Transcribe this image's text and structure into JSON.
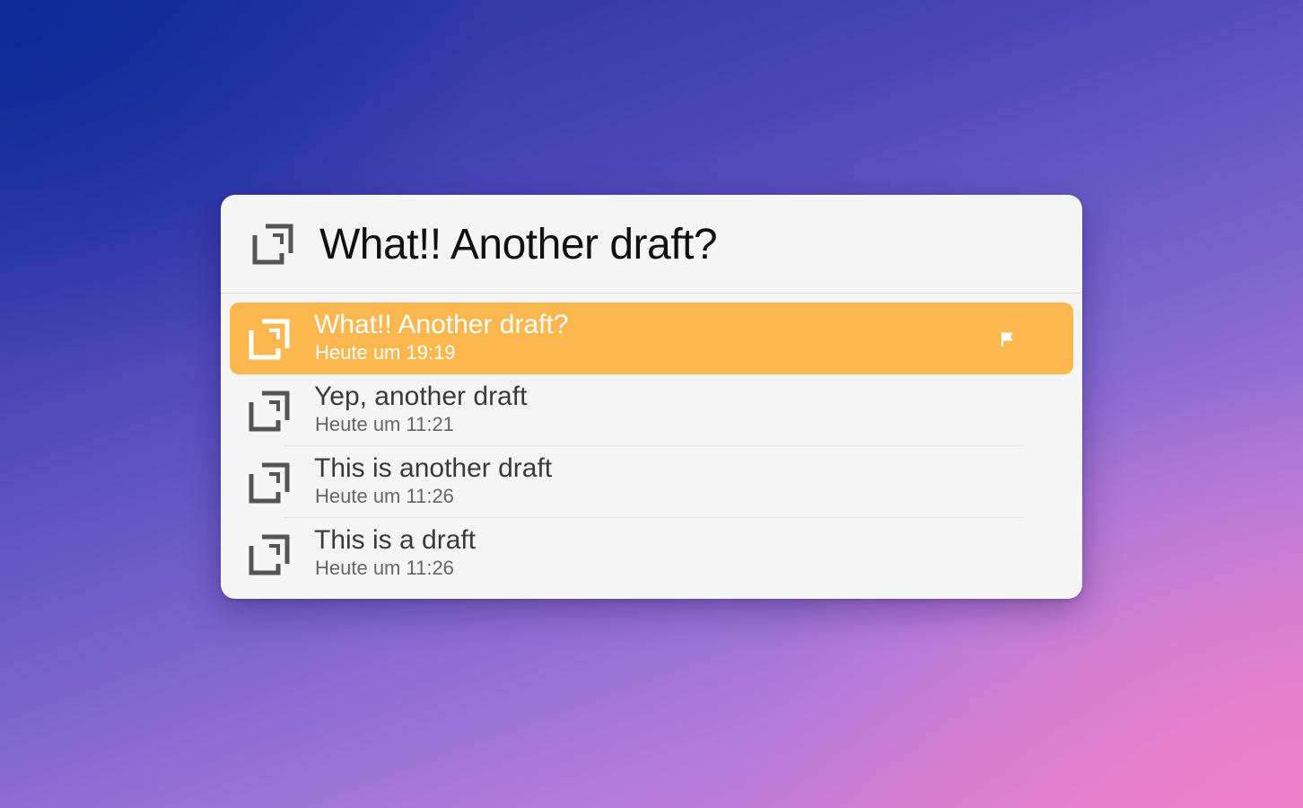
{
  "search": {
    "query": "What!! Another draft?",
    "icon": "draft-document-icon"
  },
  "results": [
    {
      "title": "What!! Another draft?",
      "subtitle": "Heute um 19:19",
      "icon": "draft-document-icon",
      "selected": true,
      "flag_icon": "flag-icon"
    },
    {
      "title": "Yep, another draft",
      "subtitle": "Heute um 11:21",
      "icon": "draft-document-icon",
      "selected": false
    },
    {
      "title": "This is another draft",
      "subtitle": "Heute um 11:26",
      "icon": "draft-document-icon",
      "selected": false
    },
    {
      "title": "This is a draft",
      "subtitle": "Heute um 11:26",
      "icon": "draft-document-icon",
      "selected": false
    }
  ],
  "colors": {
    "selection": "#fcb84f",
    "panel_background": "#f5f5f5"
  }
}
